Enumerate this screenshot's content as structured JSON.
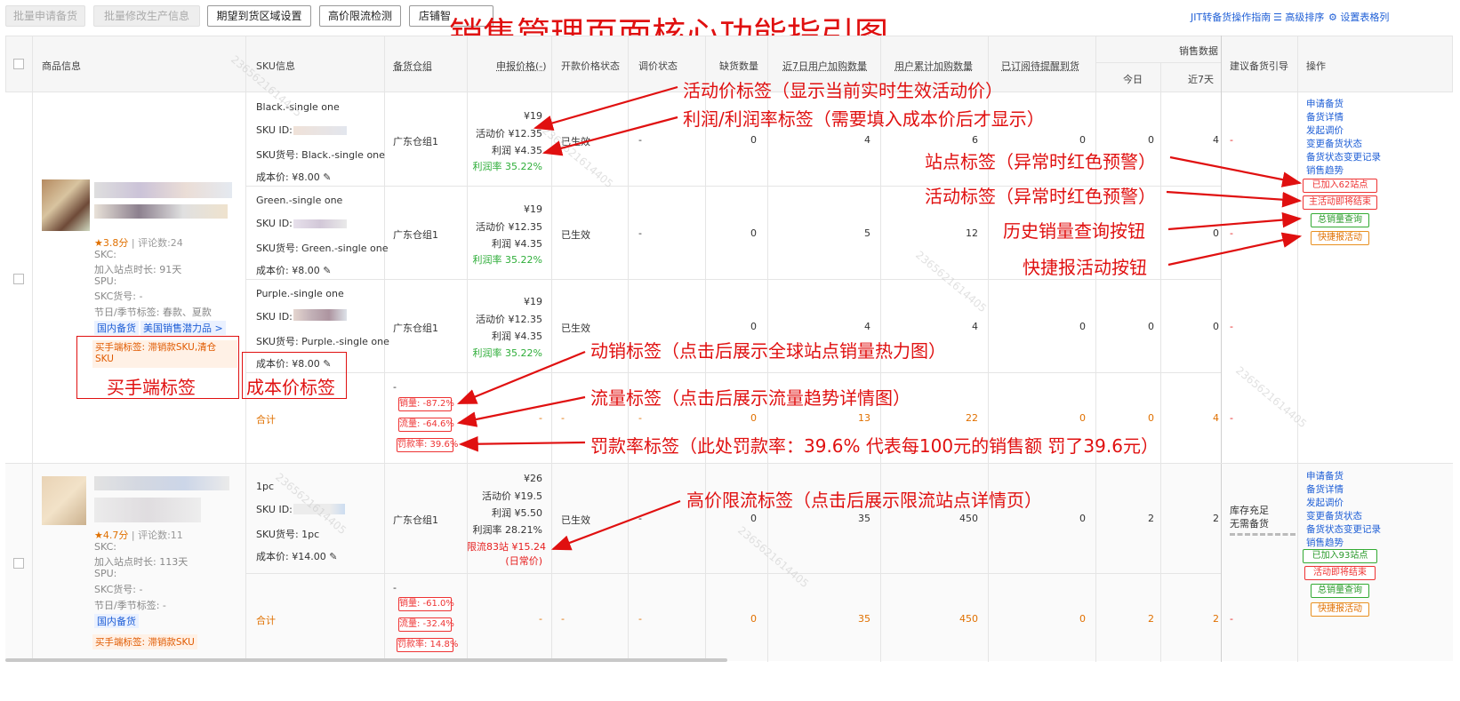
{
  "toolbar": {
    "btn1": "批量申请备货",
    "btn2": "批量修改生产信息",
    "btn3": "期望到货区域设置",
    "btn4": "高价限流检测",
    "btn5": "店铺智",
    "link1": "JIT转备货操作指南",
    "link2": "高级排序",
    "link3": "设置表格列"
  },
  "headline": "销售管理页面核心功能指引图",
  "headers": {
    "product": "商品信息",
    "sku": "SKU信息",
    "warehouse": "备货仓组",
    "price": "申报价格(-)",
    "open": "开款价格状态",
    "adjust": "调价状态",
    "shortage": "缺货数量",
    "add7": "近7日用户加购数量",
    "addtotal": "用户累计加购数量",
    "subscribed": "已订阅待提醒到货",
    "sales": "销售数据",
    "today": "今日",
    "d7": "近7天",
    "suggest": "建议备货引导",
    "ops": "操作"
  },
  "watermark": "2365621614405",
  "product1": {
    "rating": "3.8分",
    "reviews": "评论数:24",
    "skc": "SKC:",
    "days_label": "加入站点时长:",
    "days": "91天",
    "spu": "SPU:",
    "skc_no": "SKC货号: -",
    "season": "节日/季节标签: 春款、夏款",
    "tag_domestic": "国内备货",
    "tag_potential": "美国销售潜力品 >",
    "buyer_tag": "买手端标签: 滞销款SKU,清仓SKU"
  },
  "product2": {
    "rating": "4.7分",
    "reviews": "评论数:11",
    "skc": "SKC:",
    "days_label": "加入站点时长:",
    "days": "113天",
    "spu": "SPU:",
    "skc_no": "SKC货号: -",
    "season": "节日/季节标签: -",
    "tag_domestic": "国内备货",
    "buyer_tag": "买手端标签: 滞销款SKU"
  },
  "skus": [
    {
      "name": "Black.-single one",
      "id": "SKU ID:",
      "code": "SKU货号:  Black.-single one",
      "cost": "成本价: ¥8.00",
      "warehouse": "广东仓组1",
      "price": "¥19",
      "act": "活动价 ¥12.35",
      "profit": "利润 ¥4.35",
      "rate": "利润率 35.22%",
      "status": "已生效",
      "adjust": "-",
      "shortage": "0",
      "add7": "4",
      "addtotal": "6",
      "sub": "0",
      "today": "0",
      "d7": "4",
      "suggest": "-"
    },
    {
      "name": "Green.-single one",
      "id": "SKU ID:",
      "code": "SKU货号:  Green.-single one",
      "cost": "成本价: ¥8.00",
      "warehouse": "广东仓组1",
      "price": "¥19",
      "act": "活动价 ¥12.35",
      "profit": "利润 ¥4.35",
      "rate": "利润率 35.22%",
      "status": "已生效",
      "adjust": "-",
      "shortage": "0",
      "add7": "5",
      "addtotal": "12",
      "sub": "0",
      "today": "0",
      "d7": "0",
      "suggest": "-"
    },
    {
      "name": "Purple.-single one",
      "id": "SKU ID:",
      "code": "SKU货号:  Purple.-single one",
      "cost": "成本价: ¥8.00",
      "warehouse": "广东仓组1",
      "price": "¥19",
      "act": "活动价 ¥12.35",
      "profit": "利润 ¥4.35",
      "rate": "利润率 35.22%",
      "status": "已生效",
      "adjust": "-",
      "shortage": "0",
      "add7": "4",
      "addtotal": "4",
      "sub": "0",
      "today": "0",
      "d7": "0",
      "suggest": "-"
    }
  ],
  "total1": {
    "label": "合计",
    "dash": "-",
    "sales": "销量: -87.2%",
    "traffic": "流量: -64.6%",
    "penalty": "罚款率: 39.6%",
    "price": "-",
    "open": "-",
    "adjust": "-",
    "shortage": "0",
    "add7": "13",
    "addtotal": "22",
    "sub": "0",
    "today": "0",
    "d7": "4",
    "suggest": "-"
  },
  "sku4": {
    "name": "1pc",
    "id": "SKU ID:",
    "code": "SKU货号:  1pc",
    "cost": "成本价: ¥14.00",
    "warehouse": "广东仓组1",
    "price": "¥26",
    "act": "活动价 ¥19.5",
    "profit": "利润 ¥5.50",
    "rate": "利润率 28.21%",
    "limit": "限流83站 ¥15.24",
    "limit2": "(日常价)",
    "status": "已生效",
    "adjust": "-",
    "shortage": "0",
    "add7": "35",
    "addtotal": "450",
    "sub": "0",
    "today": "2",
    "d7": "2",
    "suggest": "库存充足",
    "suggest2": "无需备货"
  },
  "total2": {
    "label": "合计",
    "dash": "-",
    "sales": "销量: -61.0%",
    "traffic": "流量: -32.4%",
    "penalty": "罚款率: 14.8%",
    "price": "-",
    "open": "-",
    "adjust": "-",
    "shortage": "0",
    "add7": "35",
    "addtotal": "450",
    "sub": "0",
    "today": "2",
    "d7": "2",
    "suggest": "-"
  },
  "ops1": [
    "申请备货",
    "备货详情",
    "发起调价",
    "变更备货状态",
    "备货状态变更记录",
    "销售趋势"
  ],
  "ops2": [
    "申请备货",
    "备货详情",
    "发起调价",
    "变更备货状态",
    "备货状态变更记录",
    "销售趋势"
  ],
  "tags1": {
    "site": "已加入62站点",
    "act": "主活动即将结束",
    "hist": "总销量查询",
    "quick": "快捷报活动"
  },
  "tags2": {
    "site": "已加入93站点",
    "act": "活动即将结束",
    "hist": "总销量查询",
    "quick": "快捷报活动"
  },
  "annotations": {
    "a1": "活动价标签（显示当前实时生效活动价）",
    "a2": "利润/利润率标签（需要填入成本价后才显示）",
    "a3": "站点标签（异常时红色预警）",
    "a4": "活动标签（异常时红色预警）",
    "a5": "历史销量查询按钮",
    "a6": "快捷报活动按钮",
    "a7": "动销标签（点击后展示全球站点销量热力图）",
    "a8": "流量标签（点击后展示流量趋势详情图）",
    "a9": "罚款率标签（此处罚款率：39.6% 代表每100元的销售额 罚了39.6元）",
    "a10": "高价限流标签（点击后展示限流站点详情页）",
    "a11": "买手端标签",
    "a12": "成本价标签"
  },
  "colors": {
    "annotation": "#e01010",
    "link": "#1f5fd6",
    "green": "#2fae3a"
  }
}
